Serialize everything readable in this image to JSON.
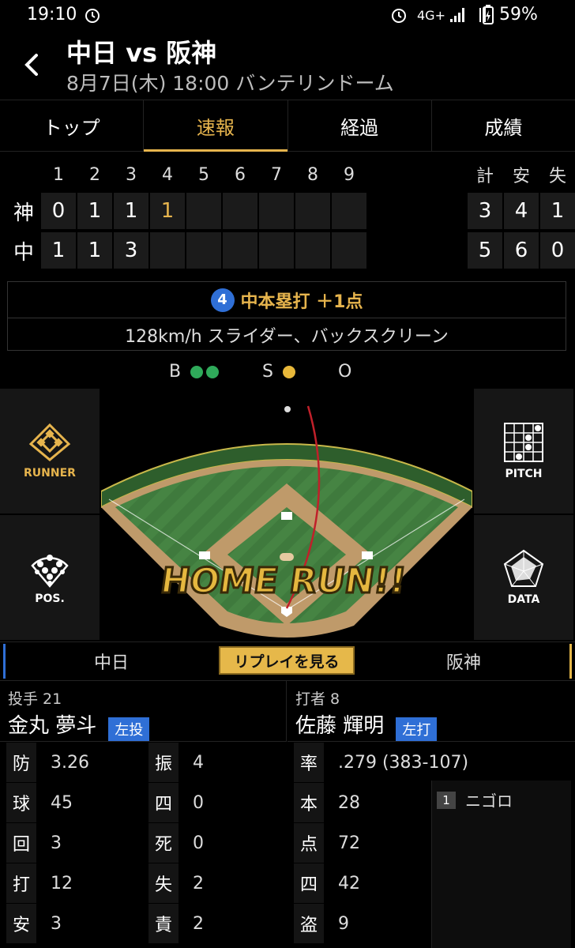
{
  "status": {
    "time": "19:10",
    "network": "4G+",
    "battery": "59%"
  },
  "header": {
    "title": "中日 vs 阪神",
    "subtitle": "8月7日(木) 18:00 バンテリンドーム"
  },
  "tabs": [
    "トップ",
    "速報",
    "経過",
    "成績"
  ],
  "scoreboard": {
    "innings": [
      "1",
      "2",
      "3",
      "4",
      "5",
      "6",
      "7",
      "8",
      "9"
    ],
    "totals_header": [
      "計",
      "安",
      "失"
    ],
    "rows": [
      {
        "team": "神",
        "scores": [
          "0",
          "1",
          "1",
          "1",
          "",
          "",
          "",
          "",
          ""
        ],
        "totals": [
          "3",
          "4",
          "1"
        ]
      },
      {
        "team": "中",
        "scores": [
          "1",
          "1",
          "3",
          "",
          "",
          "",
          "",
          "",
          ""
        ],
        "totals": [
          "5",
          "6",
          "0"
        ]
      }
    ]
  },
  "play": {
    "inning": "4",
    "headline": "中本塁打 ＋1点",
    "detail": "128km/h スライダー、バックスクリーン"
  },
  "count": {
    "b_label": "B",
    "s_label": "S",
    "o_label": "O",
    "balls": 2,
    "strikes": 1,
    "outs": 0,
    "ball_color": "#2faa5a",
    "strike_color": "#e8b83a"
  },
  "side_buttons": {
    "runner": "RUNNER",
    "pitch": "PITCH",
    "pos": "POS.",
    "data": "DATA"
  },
  "field": {
    "banner": "HOME RUN!!"
  },
  "switch": {
    "left": "中日",
    "replay": "リプレイを見る",
    "right": "阪神"
  },
  "pitcher": {
    "role": "投手 21",
    "name": "金丸 夢斗",
    "hand": "左投",
    "stats": [
      {
        "k": "防",
        "v": "3.26"
      },
      {
        "k": "球",
        "v": "45"
      },
      {
        "k": "回",
        "v": "3"
      },
      {
        "k": "打",
        "v": "12"
      },
      {
        "k": "安",
        "v": "3"
      }
    ],
    "stats2": [
      {
        "k": "振",
        "v": "4"
      },
      {
        "k": "四",
        "v": "0"
      },
      {
        "k": "死",
        "v": "0"
      },
      {
        "k": "失",
        "v": "2"
      },
      {
        "k": "責",
        "v": "2"
      }
    ]
  },
  "batter": {
    "role": "打者 8",
    "name": "佐藤 輝明",
    "hand": "左打",
    "stats": [
      {
        "k": "率",
        "v": ".279 (383-107)"
      },
      {
        "k": "本",
        "v": "28"
      },
      {
        "k": "点",
        "v": "72"
      },
      {
        "k": "四",
        "v": "42"
      },
      {
        "k": "盗",
        "v": "9"
      }
    ],
    "at_bats": [
      {
        "num": "1",
        "result": "ニゴロ"
      }
    ]
  }
}
